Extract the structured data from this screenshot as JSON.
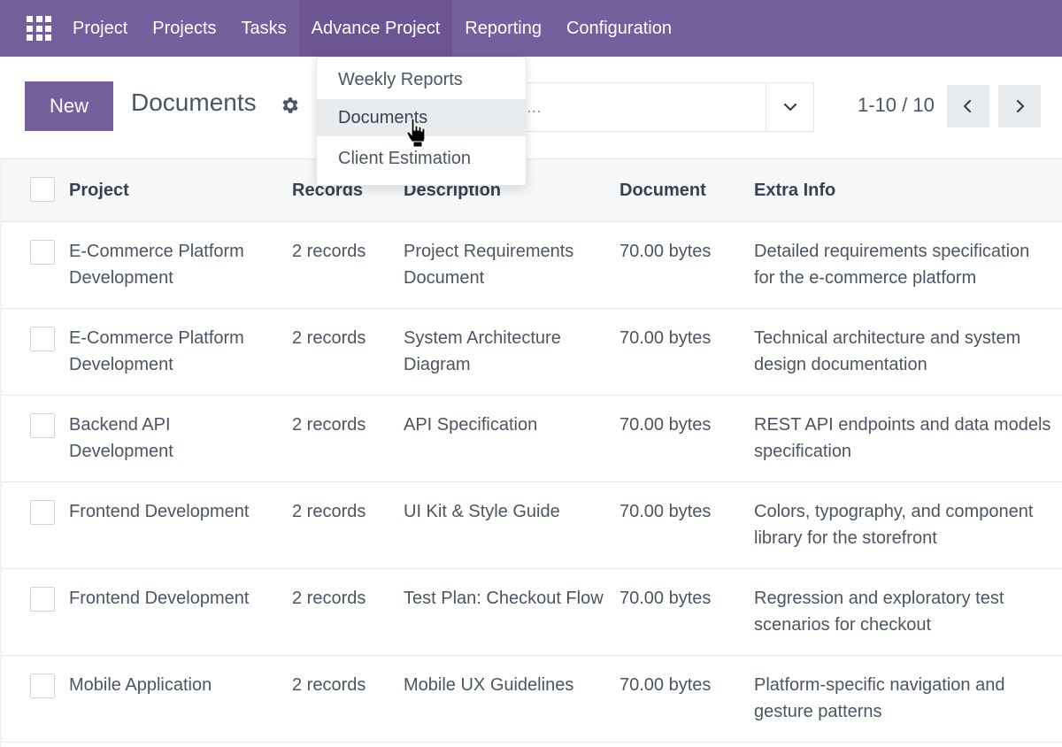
{
  "navbar": {
    "apps_icon": "apps-grid-icon",
    "items": [
      {
        "label": "Project"
      },
      {
        "label": "Projects"
      },
      {
        "label": "Tasks"
      },
      {
        "label": "Advance Project"
      },
      {
        "label": "Reporting"
      },
      {
        "label": "Configuration"
      }
    ],
    "active_item": "Advance Project",
    "color": "#765f9d"
  },
  "dropdown": {
    "items": [
      {
        "label": "Weekly Reports"
      },
      {
        "label": "Documents"
      },
      {
        "label": "Client Estimation"
      }
    ],
    "hovered_item": "Documents"
  },
  "control_panel": {
    "new_label": "New",
    "title": "Documents",
    "gear_icon": "gear-icon",
    "search_placeholder": "...",
    "pager": "1-10 / 10"
  },
  "table": {
    "headers": {
      "project": "Project",
      "records": "Records",
      "description": "Description",
      "document": "Document",
      "extra": "Extra Info"
    },
    "rows": [
      {
        "project": "E-Commerce Platform Development",
        "records": "2 records",
        "description": "Project Requirements Document",
        "document": "70.00 bytes",
        "extra": "Detailed requirements specification for the e-commerce platform"
      },
      {
        "project": "E-Commerce Platform Development",
        "records": "2 records",
        "description": "System Architecture Diagram",
        "document": "70.00 bytes",
        "extra": "Technical architecture and system design documentation"
      },
      {
        "project": "Backend API Development",
        "records": "2 records",
        "description": "API Specification",
        "document": "70.00 bytes",
        "extra": "REST API endpoints and data models specification"
      },
      {
        "project": "Frontend Development",
        "records": "2 records",
        "description": "UI Kit & Style Guide",
        "document": "70.00 bytes",
        "extra": "Colors, typography, and component library for the storefront"
      },
      {
        "project": "Frontend Development",
        "records": "2 records",
        "description": "Test Plan: Checkout Flow",
        "document": "70.00 bytes",
        "extra": "Regression and exploratory test scenarios for checkout"
      },
      {
        "project": "Mobile Application",
        "records": "2 records",
        "description": "Mobile UX Guidelines",
        "document": "70.00 bytes",
        "extra": "Platform-specific navigation and gesture patterns"
      }
    ]
  }
}
